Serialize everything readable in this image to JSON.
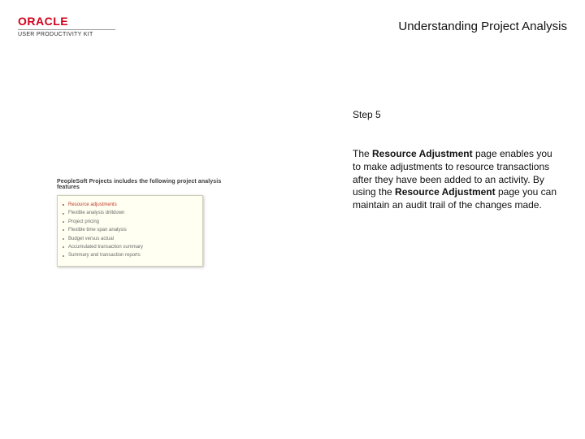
{
  "header": {
    "brand_word": "ORACLE",
    "brand_subline": "USER PRODUCTIVITY KIT",
    "page_title": "Understanding Project Analysis"
  },
  "thumbnail": {
    "heading": "PeopleSoft Projects includes the following project analysis features",
    "items": [
      {
        "label": "Resource adjustments",
        "highlight": true
      },
      {
        "label": "Flexible analysis drilldown",
        "highlight": false
      },
      {
        "label": "Project pricing",
        "highlight": false
      },
      {
        "label": "Flexible time span analysis",
        "highlight": false
      },
      {
        "label": "Budget versus actual",
        "highlight": false
      },
      {
        "label": "Accumulated transaction summary",
        "highlight": false
      },
      {
        "label": "Summary and transaction reports",
        "highlight": false
      }
    ]
  },
  "right": {
    "step_label": "Step 5",
    "para_prefix": "The ",
    "bold1": "Resource Adjustment",
    "para_mid1": " page enables you to make adjustments to resource transactions after they have been added to an activity. By using the ",
    "bold2": "Resource Adjustment",
    "para_suffix": " page you can maintain an audit trail of the changes made."
  }
}
